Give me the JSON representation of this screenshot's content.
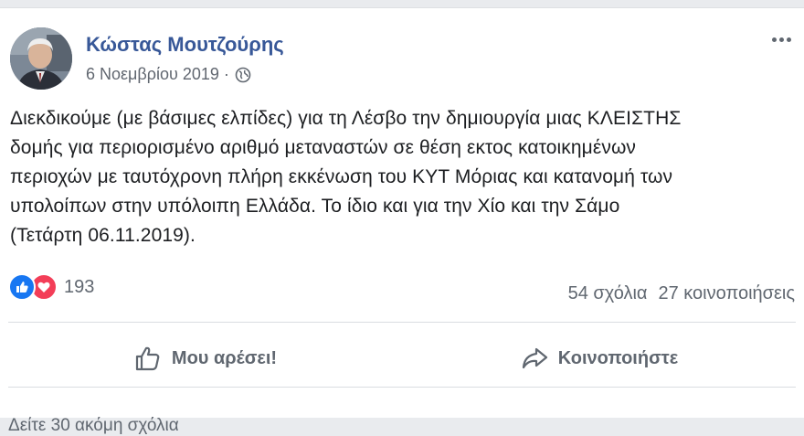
{
  "post": {
    "author": "Κώστας Μουτζούρης",
    "date": "6 Νοεμβρίου 2019",
    "separator": "·",
    "privacy_icon": "globe-icon",
    "body_lines": [
      "Διεκδικούμε (με βάσιμες ελπίδες) για τη Λέσβο την δημιουργία μιας ΚΛΕΙΣΤΗΣ",
      "δομής για περιορισμένο αριθμό μεταναστών σε θέση εκτος κατοικημένων",
      "περιοχών με ταυτόχρονη πλήρη εκκένωση του ΚΥΤ Μόριας και κατανομή των",
      "υπολοίπων στην υπόλοιπη Ελλάδα. Το ίδιο και για την Χίο και την Σάμο",
      "(Τετάρτη 06.11.2019)."
    ]
  },
  "reactions": {
    "count": "193",
    "types": [
      "like-icon",
      "love-icon"
    ]
  },
  "stats": {
    "comments": "54 σχόλια",
    "shares": "27 κοινοποιήσεις"
  },
  "actions": {
    "like_label": "Μου αρέσει!",
    "share_label": "Κοινοποιήστε"
  },
  "footer": {
    "more_comments": "Δείτε 30 ακόμη σχόλια"
  },
  "colors": {
    "author_link": "#385898",
    "like_blue": "#1877f2",
    "love_red": "#f33e58",
    "secondary_text": "#606770"
  }
}
